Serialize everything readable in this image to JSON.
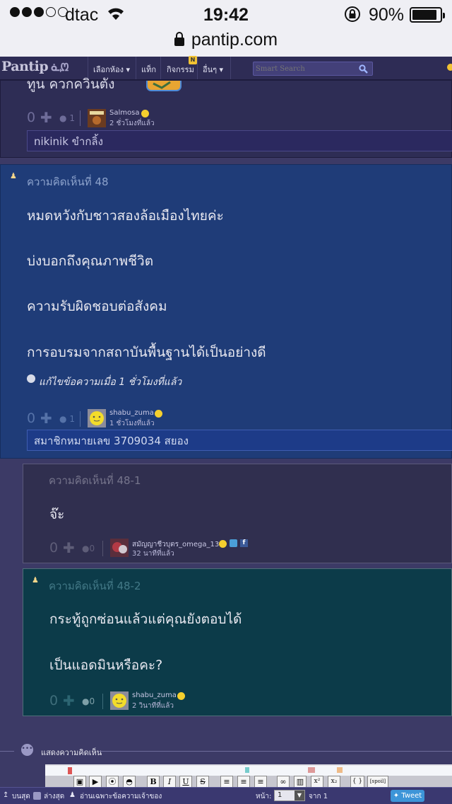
{
  "status_bar": {
    "carrier": "dtac",
    "time": "19:42",
    "battery_percent": "90%",
    "battery_level": 0.9,
    "url": "pantip.com"
  },
  "nav": {
    "logo": "Pantip",
    "logo_mark": "ᓈᘻ",
    "items": [
      "เลือกห้อง ▾",
      "แท็ก",
      "กิจกรรม",
      "อื่นๆ ▾"
    ],
    "activity_badge": "N",
    "search_placeholder": "Smart Search"
  },
  "comment_47": {
    "partial_text": "ทูน ควกควินตัง",
    "score": "0",
    "reply_count": "1",
    "author": "Salmosa",
    "time": "2 ชั่วโมงที่แล้ว",
    "signature": "nikinik ขำกลิ้ง"
  },
  "comment_48": {
    "label": "ความคิดเห็นที่ 48",
    "lines": [
      "หมดหวังกับชาวสองล้อเมืองไทยค่ะ",
      "บ่งบอกถึงคุณภาพชีวิต",
      "ความรับผิดชอบต่อสังคม",
      "การอบรมจากสถาบันพื้นฐานได้เป็นอย่างดี"
    ],
    "edited": "แก้ไขข้อความเมื่อ 1 ชั่วโมงที่แล้ว",
    "score": "0",
    "reply_count": "1",
    "author": "shabu_zuma",
    "time": "1 ชั่วโมงที่แล้ว",
    "signature": "สมาชิกหมายเลข 3709034 สยอง"
  },
  "comment_48_1": {
    "label": "ความคิดเห็นที่ 48-1",
    "text": "จ๊ะ",
    "score": "0",
    "reply_count": "0",
    "author": "สมัญญาชีวบุตร_omega_13",
    "time": "32 นาทีที่แล้ว"
  },
  "comment_48_2": {
    "label": "ความคิดเห็นที่ 48-2",
    "lines": [
      "กระทู้ถูกซ่อนแล้วแต่คุณยังตอบได้",
      "เป็นแอดมินหรือคะ?"
    ],
    "score": "0",
    "reply_count": "0",
    "author": "shabu_zuma",
    "time": "2 วินาทีที่แล้ว"
  },
  "show_comment": "แสดงความคิดเห็น",
  "editor_toolbar": [
    "B",
    "I",
    "U",
    "S",
    "x²",
    "x₂",
    "{ }",
    "[spoil]"
  ],
  "bottom_bar": {
    "top_label": "บนสุด",
    "bottom_label": "ล่างสุด",
    "owner_only": "อ่านเฉพาะข้อความเจ้าของ",
    "page_label": "หน้า:",
    "page_value": "1",
    "page_total": "จาก 1",
    "tweet": "Tweet"
  },
  "colors": {
    "page_bg": "#3c3a66",
    "comment_48_bg": "#1f3c78",
    "comment_48_1_bg": "#302f4f",
    "comment_48_2_bg": "#0c3b49",
    "text_light": "#e8e8f0"
  }
}
